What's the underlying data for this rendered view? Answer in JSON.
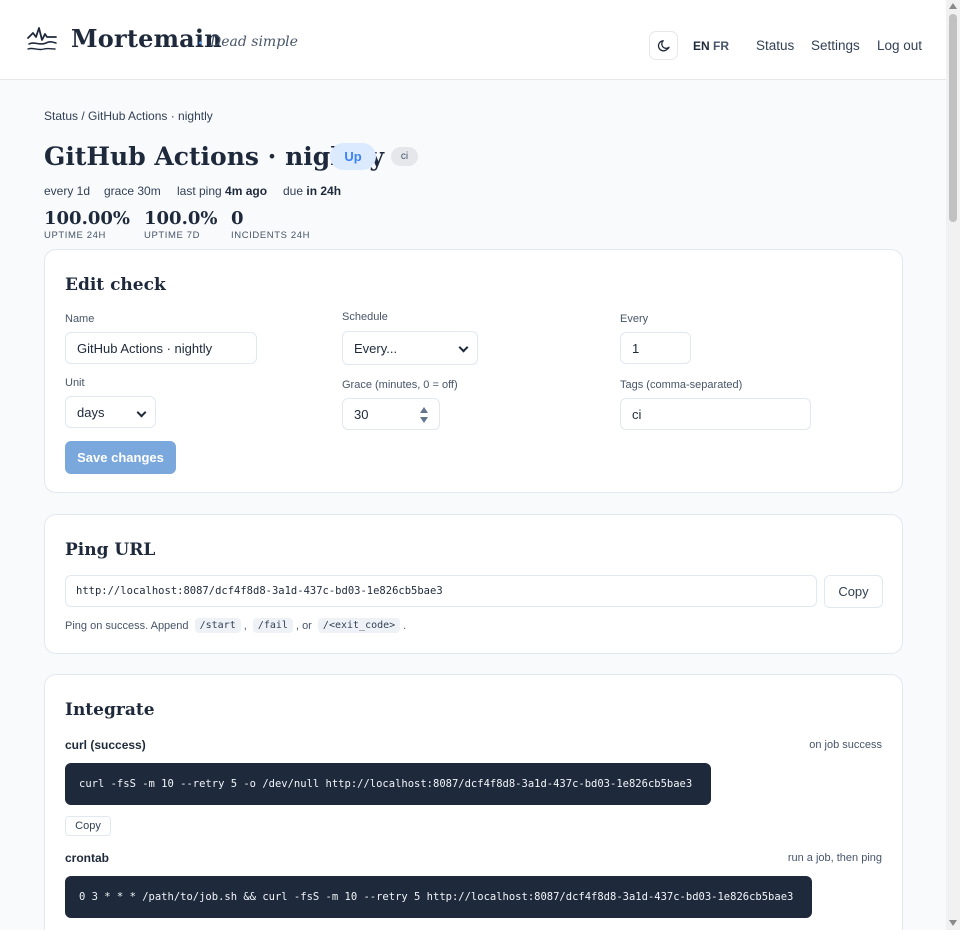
{
  "header": {
    "brand": "Mortemain",
    "brand_dot": ".",
    "tagline": "Dead simple",
    "lang_en": "EN",
    "lang_fr": "FR",
    "nav": {
      "status": "Status",
      "settings": "Settings",
      "logout": "Log out"
    }
  },
  "breadcrumb": "Status / GitHub Actions · nightly",
  "check": {
    "title": "GitHub Actions · nightly",
    "status_badge": "Up",
    "tag": "ci",
    "meta": {
      "every": "every 1d",
      "grace": "grace 30m",
      "last_ping_label": "last ping",
      "last_ping_value": "4m ago",
      "due_label": "due",
      "due_value": "in 24h"
    },
    "stats": [
      {
        "value": "100.00%",
        "label": "UPTIME 24H"
      },
      {
        "value": "100.0%",
        "label": "UPTIME 7D"
      },
      {
        "value": "0",
        "label": "INCIDENTS 24H"
      }
    ]
  },
  "edit": {
    "title": "Edit check",
    "name_label": "Name",
    "name_value": "GitHub Actions · nightly",
    "schedule_label": "Schedule",
    "schedule_value": "Every...",
    "every_label": "Every",
    "every_value": "1",
    "unit_label": "Unit",
    "unit_value": "days",
    "grace_label": "Grace (minutes, 0 = off)",
    "grace_value": "30",
    "tags_label": "Tags (comma-separated)",
    "tags_value": "ci",
    "save_label": "Save changes"
  },
  "ping": {
    "title": "Ping URL",
    "url": "http://localhost:8087/dcf4f8d8-3a1d-437c-bd03-1e826cb5bae3",
    "copy_label": "Copy",
    "hint_prefix": "Ping on success. Append",
    "hint_start": "/start",
    "hint_comma": ",",
    "hint_fail": "/fail",
    "hint_or": ", or",
    "hint_exit": "/<exit_code>",
    "hint_end": "."
  },
  "integrate": {
    "title": "Integrate",
    "items": [
      {
        "label": "curl (success)",
        "note": "on job success",
        "code": "curl -fsS -m 10 --retry 5 -o /dev/null http://localhost:8087/dcf4f8d8-3a1d-437c-bd03-1e826cb5bae3",
        "copy_label": "Copy"
      },
      {
        "label": "crontab",
        "note": "run a job, then ping",
        "code": "0 3 * * * /path/to/job.sh && curl -fsS -m 10 --retry 5 http://localhost:8087/dcf4f8d8-3a1d-437c-bd03-1e826cb5bae3"
      }
    ]
  }
}
